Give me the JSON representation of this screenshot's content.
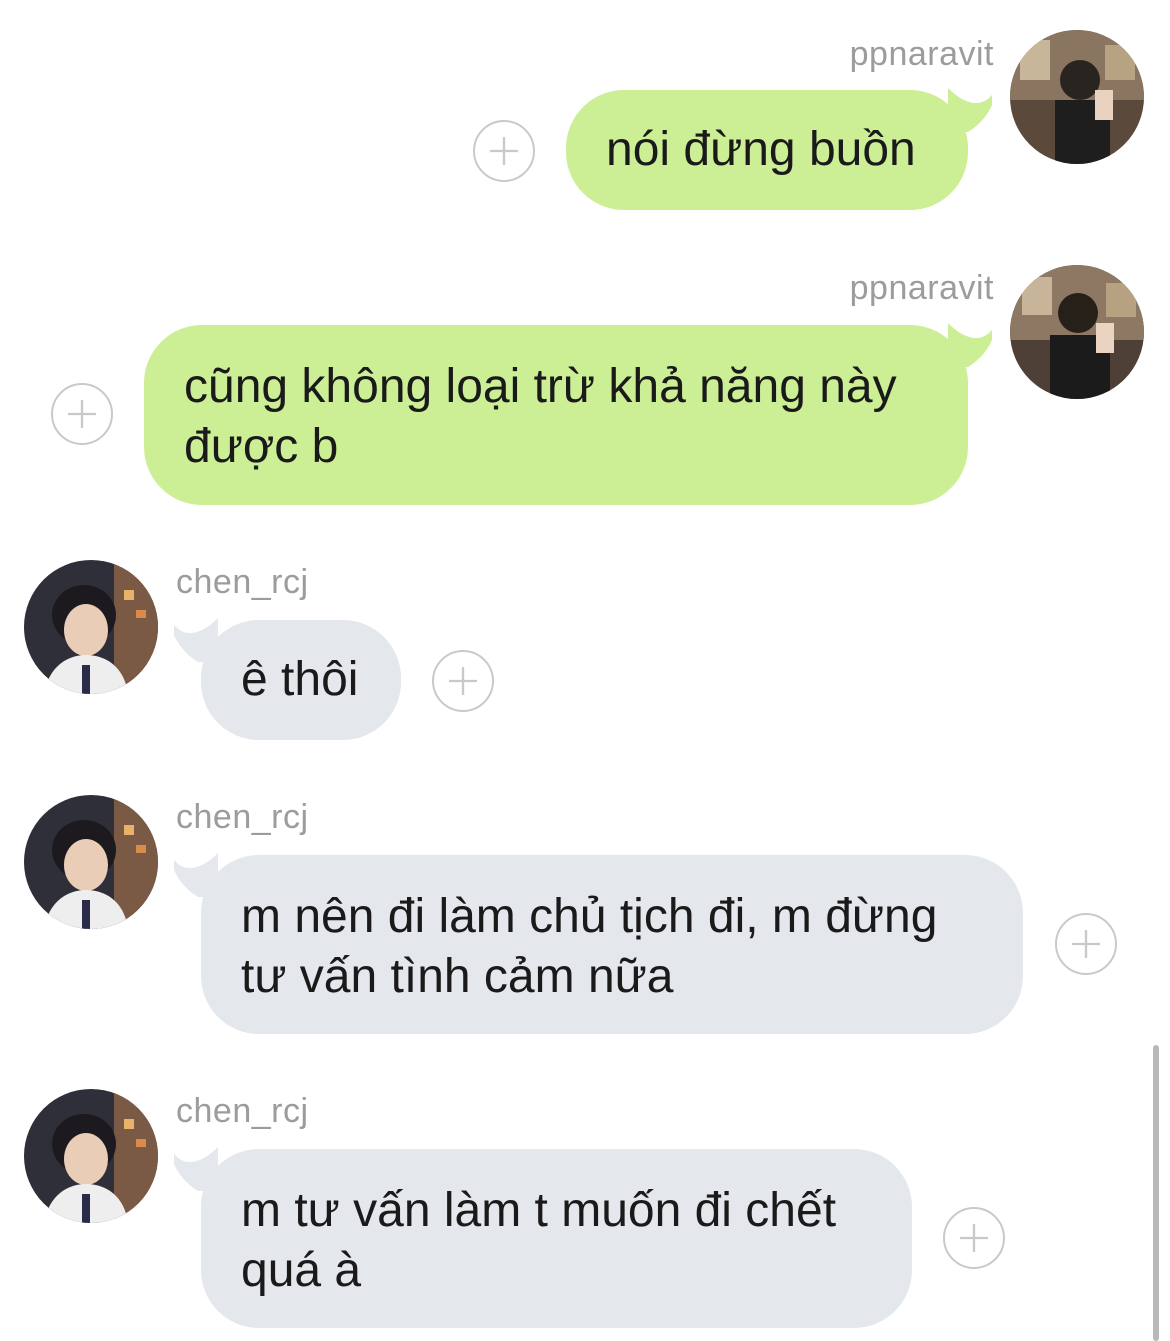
{
  "icons": {
    "add": "plus-circle-icon"
  },
  "colors": {
    "outgoing_bubble": "#ccef96",
    "incoming_bubble": "#e4e7eb",
    "sender_name": "#9c9c9c"
  },
  "messages": [
    {
      "sender": "ppnaravit",
      "text": "nói đừng buồn",
      "direction": "outgoing"
    },
    {
      "sender": "ppnaravit",
      "text": "cũng không loại trừ khả năng này được b",
      "direction": "outgoing"
    },
    {
      "sender": "chen_rcj",
      "text": "ê thôi",
      "direction": "incoming"
    },
    {
      "sender": "chen_rcj",
      "text": "m nên đi làm chủ tịch đi, m đừng tư vấn tình cảm nữa",
      "direction": "incoming"
    },
    {
      "sender": "chen_rcj",
      "text": "m tư vấn làm t muốn đi chết quá à",
      "direction": "incoming"
    }
  ]
}
